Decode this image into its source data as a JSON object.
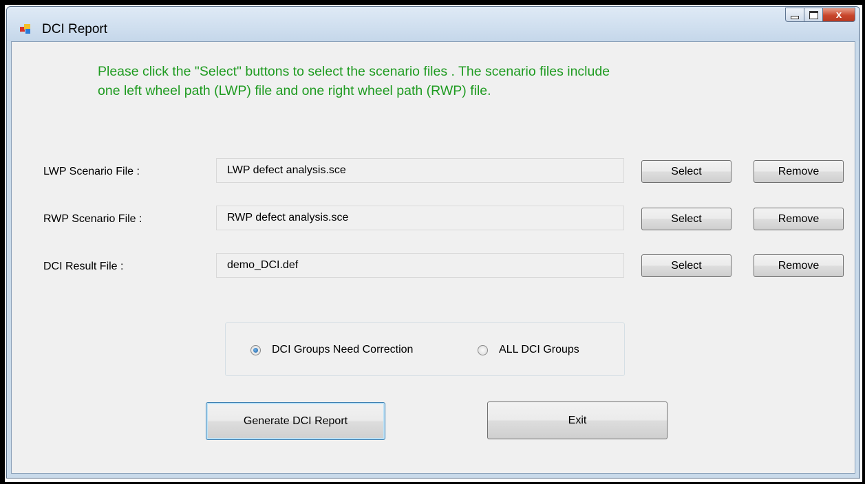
{
  "window": {
    "title": "DCI Report",
    "close_glyph": "x"
  },
  "instruction_lines": [
    "Please click the \"Select\" buttons to select the  scenario files . The scenario files include",
    "one left wheel path (LWP) file and one right wheel path (RWP) file."
  ],
  "files": [
    {
      "label": "LWP Scenario File :",
      "value": "LWP defect analysis.sce",
      "select_label": "Select",
      "remove_label": "Remove"
    },
    {
      "label": "RWP Scenario File :",
      "value": "RWP defect analysis.sce",
      "select_label": "Select",
      "remove_label": "Remove"
    },
    {
      "label": "DCI Result File :",
      "value": "demo_DCI.def",
      "select_label": "Select",
      "remove_label": "Remove"
    }
  ],
  "options": {
    "items": [
      {
        "label": "DCI Groups Need Correction",
        "selected": true
      },
      {
        "label": "ALL DCI Groups",
        "selected": false
      }
    ]
  },
  "actions": {
    "generate_label": "Generate DCI Report",
    "exit_label": "Exit"
  },
  "colors": {
    "instruction_text": "#1f9b21",
    "titlebar": "#c9daea",
    "client": "#f0f0f0"
  }
}
